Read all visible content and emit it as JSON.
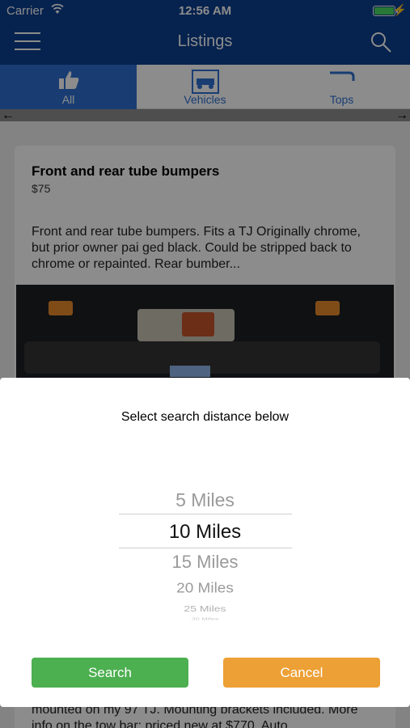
{
  "status_bar": {
    "carrier": "Carrier",
    "time": "12:56 AM"
  },
  "nav": {
    "title": "Listings"
  },
  "tabs": [
    {
      "label": "All",
      "icon": "thumbs-up-icon",
      "active": true
    },
    {
      "label": "Vehicles",
      "icon": "jeep-icon",
      "active": false
    },
    {
      "label": "Tops",
      "icon": "top-icon",
      "active": false
    }
  ],
  "listing": {
    "title": "Front and rear tube bumpers",
    "price": "$75",
    "description": "Front and rear tube bumpers.  Fits a TJ Originally chrome, but prior owner pai ged black.  Could be stripped back to chrome or repainted. Rear bumber...",
    "description_lower": "mounted on my 97 TJ.  Mounting brackets included. More info on the tow bar:  priced new at $770. Auto..."
  },
  "sheet": {
    "prompt": "Select search distance below",
    "options": [
      "5 Miles",
      "10 Miles",
      "15 Miles",
      "20 Miles",
      "25 Miles",
      "30 Miles"
    ],
    "selected": "10 Miles",
    "search_label": "Search",
    "cancel_label": "Cancel"
  },
  "colors": {
    "nav": "#0b3f8f",
    "tab_active": "#2f6fcf",
    "search_button": "#4caf50",
    "cancel_button": "#eda035"
  }
}
